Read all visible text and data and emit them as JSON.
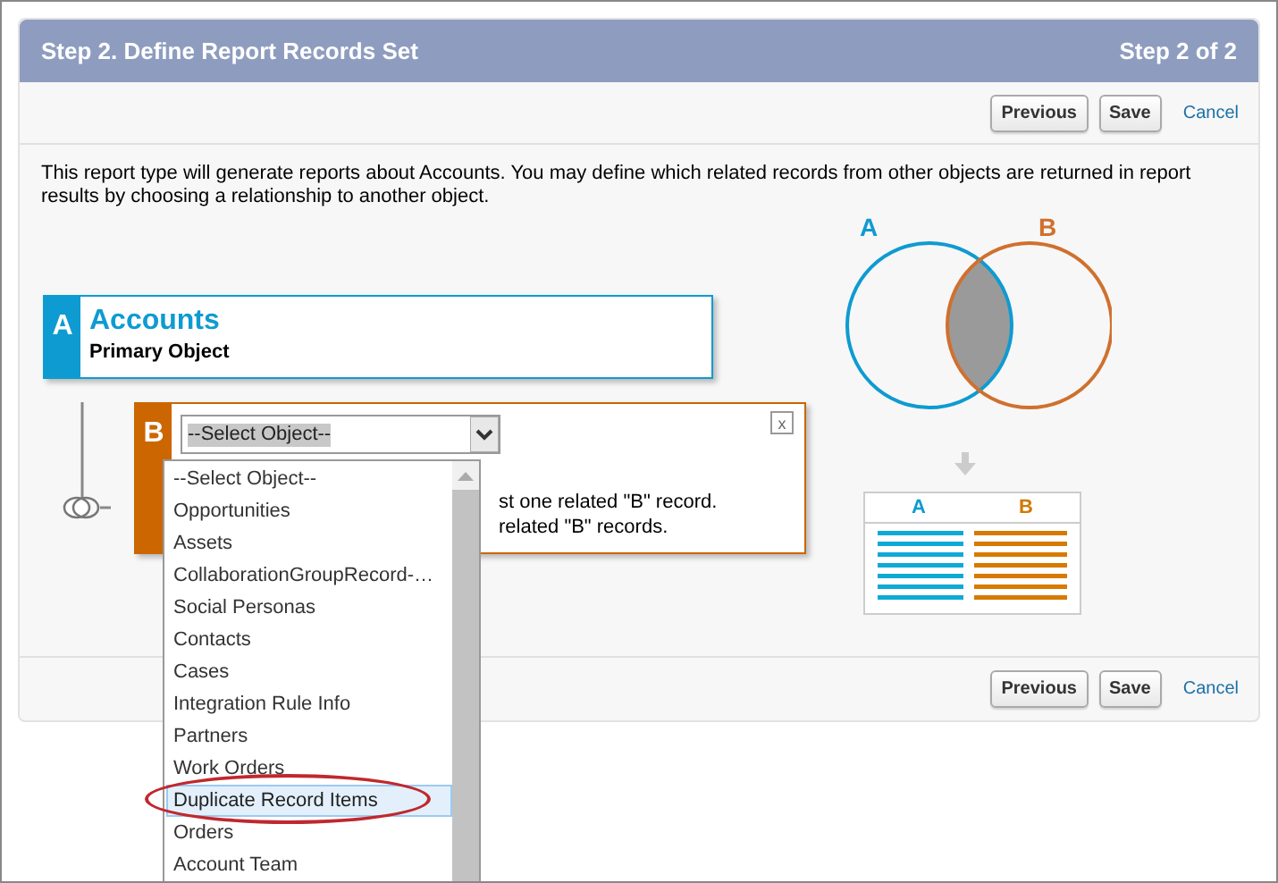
{
  "header": {
    "title": "Step 2. Define Report Records Set",
    "step": "Step 2 of 2"
  },
  "top_buttons": [
    {
      "label": "Previous",
      "kind": "button"
    },
    {
      "label": "Save",
      "kind": "button"
    },
    {
      "label": "Cancel",
      "kind": "link"
    }
  ],
  "description": "This report type will generate reports about Accounts. You may define which related records from other objects are returned in report results by choosing a relationship to another object.",
  "object_a": {
    "letter": "A",
    "name": "Accounts",
    "subtitle": "Primary Object"
  },
  "object_b": {
    "letter": "B",
    "select_value": "--Select Object--",
    "close": "x",
    "option_texts": [
      "st one related \"B\" record.",
      "related \"B\" records."
    ],
    "dropdown": {
      "expanded": true,
      "options": [
        {
          "label": "--Select Object--",
          "selected": false,
          "circled": false
        },
        {
          "label": "Opportunities",
          "selected": false,
          "circled": false
        },
        {
          "label": "Assets",
          "selected": false,
          "circled": false
        },
        {
          "label": "CollaborationGroupRecord-…",
          "selected": false,
          "circled": false
        },
        {
          "label": "Social Personas",
          "selected": false,
          "circled": false
        },
        {
          "label": "Contacts",
          "selected": false,
          "circled": false
        },
        {
          "label": "Cases",
          "selected": false,
          "circled": false
        },
        {
          "label": "Integration Rule Info",
          "selected": false,
          "circled": false
        },
        {
          "label": "Partners",
          "selected": false,
          "circled": false
        },
        {
          "label": "Work Orders",
          "selected": false,
          "circled": false
        },
        {
          "label": "Duplicate Record Items",
          "selected": true,
          "circled": true
        },
        {
          "label": "Orders",
          "selected": false,
          "circled": false
        },
        {
          "label": "Account Team",
          "selected": false,
          "circled": false
        }
      ]
    }
  },
  "venn": {
    "label_a": "A",
    "label_b": "B"
  },
  "result_table": {
    "columns": [
      "A",
      "B"
    ]
  },
  "bottom_buttons": [
    {
      "label": "Previous",
      "kind": "button"
    },
    {
      "label": "Save",
      "kind": "button"
    },
    {
      "label": "Cancel",
      "kind": "link"
    }
  ]
}
